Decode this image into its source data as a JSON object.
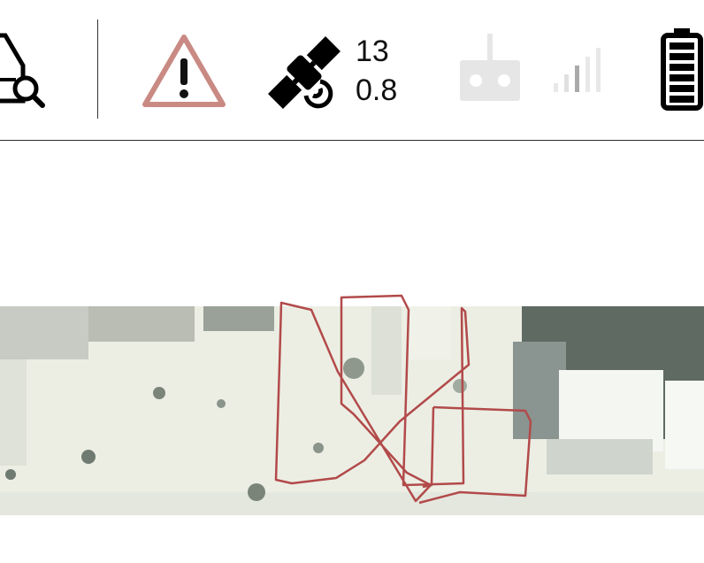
{
  "toolbar": {
    "gps": {
      "satellite_count": "13",
      "hdop": "0.8"
    }
  },
  "icons": {
    "analyze": "vehicle-search-icon",
    "warning": "warning-triangle-icon",
    "gps": "satellite-icon",
    "rc": "rc-transmitter-icon",
    "rc_signal": "signal-bars-icon",
    "battery": "battery-icon"
  },
  "colors": {
    "warning": "#c98a84",
    "track": "#b24a4a",
    "inactive": "#e6e6e6",
    "text": "#111111"
  },
  "signal": {
    "level": 0.5
  },
  "battery": {
    "level": 1.0
  }
}
